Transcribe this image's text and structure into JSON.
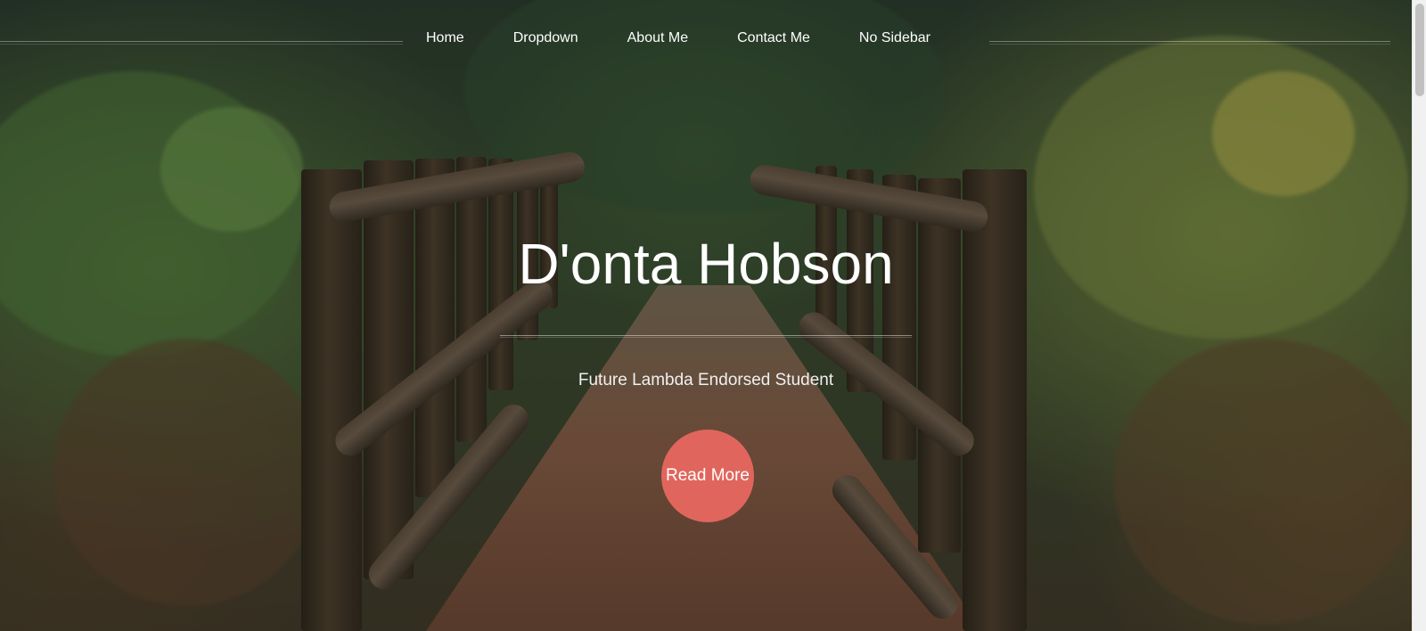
{
  "nav": {
    "items": [
      {
        "label": "Home"
      },
      {
        "label": "Dropdown"
      },
      {
        "label": "About Me"
      },
      {
        "label": "Contact Me"
      },
      {
        "label": "No Sidebar"
      }
    ]
  },
  "hero": {
    "title": "D'onta Hobson",
    "subtitle": "Future Lambda Endorsed Student",
    "button_label": "Read More",
    "background_description": "forest-bridge-photo"
  },
  "colors": {
    "accent": "#e0665d",
    "text": "#ffffff"
  }
}
